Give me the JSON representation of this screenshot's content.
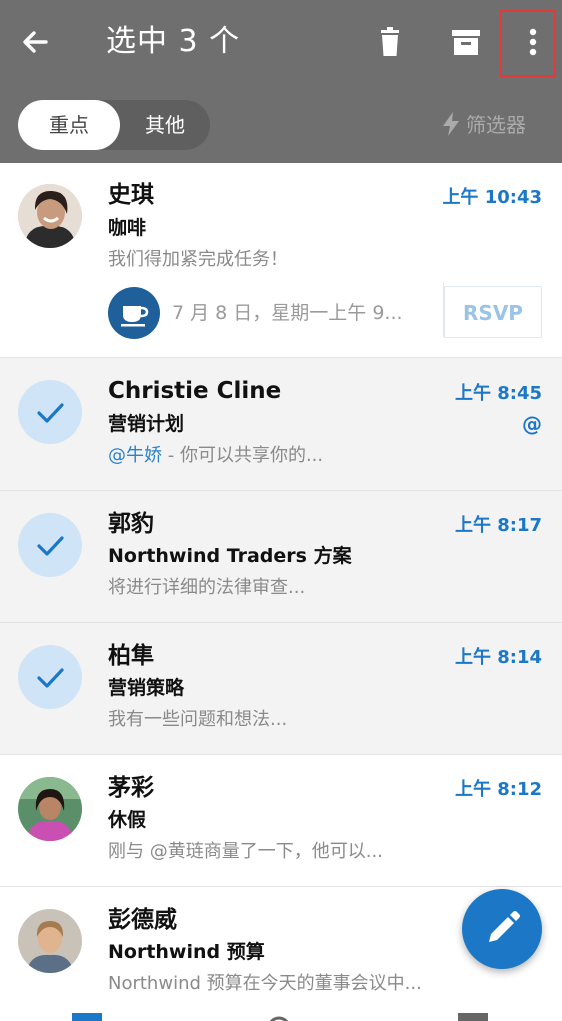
{
  "header": {
    "title": "选中 3 个",
    "accent_color": "#1c78c6",
    "header_color": "#6f6f6f",
    "icons": [
      "back-arrow-icon",
      "delete-icon",
      "archive-icon",
      "more-icon"
    ]
  },
  "tabs": {
    "focused": "重点",
    "other": "其他",
    "filter_label": "筛选器",
    "filter_icon": "bolt-icon"
  },
  "emails": [
    {
      "sender": "史琪",
      "subject": "咖啡",
      "preview": "我们得加紧完成任务！",
      "time": "上午 10:43",
      "selected": false,
      "avatar": "photo",
      "event": {
        "icon": "coffee-cup-icon",
        "text": "7 月 8 日，星期一上午 9...",
        "rsvp": "RSVP"
      }
    },
    {
      "sender": "Christie Cline",
      "subject": "营销计划",
      "preview_mention": "@牛娇",
      "preview": " - 你可以共享你的...",
      "time": "上午 8:45",
      "mention_badge": "@",
      "selected": true
    },
    {
      "sender": "郭豹",
      "subject": "Northwind Traders 方案",
      "preview": "将进行详细的法律审查...",
      "time": "上午 8:17",
      "selected": true
    },
    {
      "sender": "柏隼",
      "subject": "营销策略",
      "preview": "我有一些问题和想法...",
      "time": "上午 8:14",
      "selected": true
    },
    {
      "sender": "茅彩",
      "subject": "休假",
      "preview": "刚与 @黄琏商量了一下，他可以...",
      "time": "上午 8:12",
      "selected": false,
      "avatar": "photo"
    },
    {
      "sender": "彭德威",
      "subject": "Northwind 预算",
      "preview": "Northwind 预算在今天的董事会议中...",
      "time": "",
      "selected": false,
      "avatar": "photo"
    }
  ],
  "fab": {
    "icon": "compose-pencil-icon"
  },
  "bottom_nav": [
    "mail-icon",
    "search-icon",
    "calendar-icon"
  ]
}
